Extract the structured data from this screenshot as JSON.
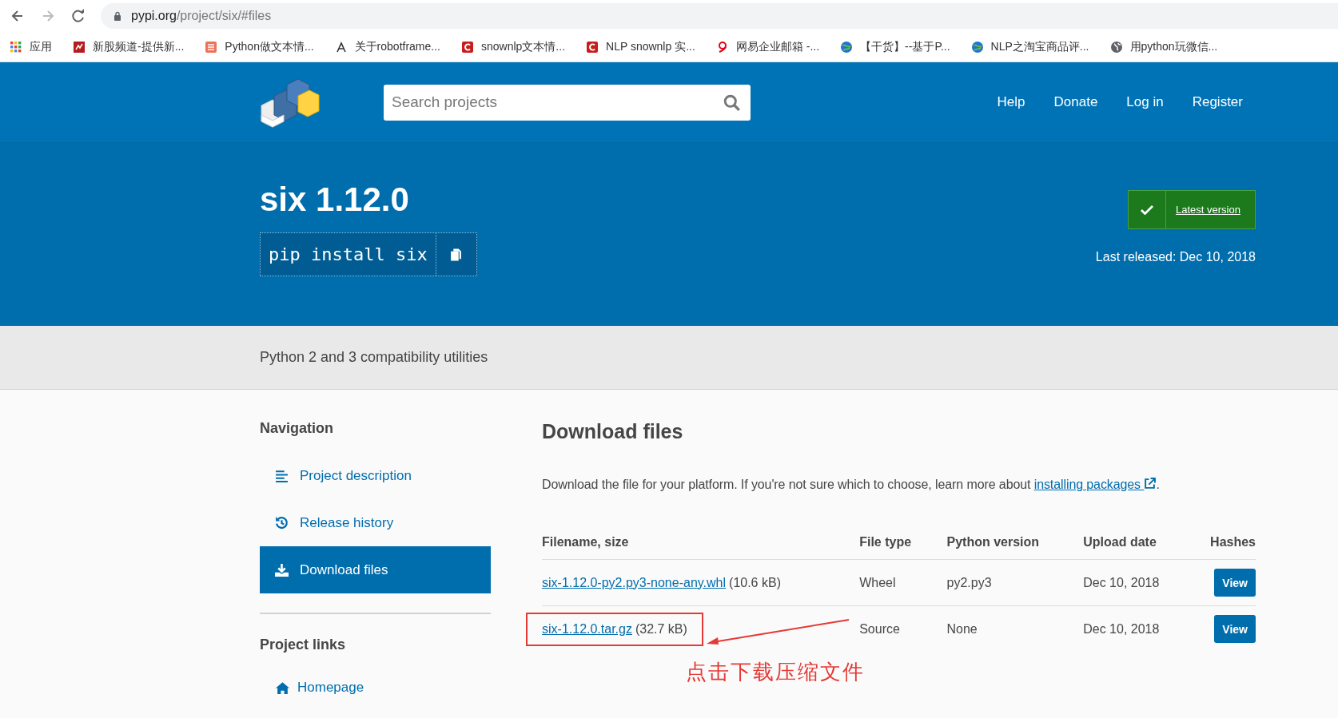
{
  "browser": {
    "url_host": "pypi.org",
    "url_path": "/project/six/#files",
    "bookmarks": [
      {
        "kind": "apps",
        "label": "应用"
      },
      {
        "kind": "stock",
        "label": "新股频道-提供新..."
      },
      {
        "kind": "jian",
        "label": "Python做文本情..."
      },
      {
        "kind": "robot",
        "label": "关于robotframe..."
      },
      {
        "kind": "csdn",
        "label": "snownlp文本情..."
      },
      {
        "kind": "csdn",
        "label": "NLP snownlp 实..."
      },
      {
        "kind": "netease",
        "label": "网易企业邮箱 -..."
      },
      {
        "kind": "globe",
        "label": "【干货】--基于P..."
      },
      {
        "kind": "globe",
        "label": "NLP之淘宝商品评..."
      },
      {
        "kind": "world",
        "label": "用python玩微信..."
      }
    ]
  },
  "header": {
    "search": {
      "placeholder": "Search projects"
    },
    "nav": [
      "Help",
      "Donate",
      "Log in",
      "Register"
    ]
  },
  "project": {
    "title": "six 1.12.0",
    "install_command": "pip install six",
    "latest_version": "Latest version",
    "last_released": "Last released: Dec 10, 2018",
    "summary": "Python 2 and 3 compatibility utilities"
  },
  "sidebar": {
    "heading": "Navigation",
    "items": [
      {
        "kind": "description",
        "label": "Project description",
        "selected": false
      },
      {
        "kind": "history",
        "label": "Release history",
        "selected": false
      },
      {
        "kind": "download",
        "label": "Download files",
        "selected": true
      }
    ],
    "links_heading": "Project links",
    "links": [
      {
        "kind": "home",
        "label": "Homepage"
      }
    ]
  },
  "main": {
    "heading": "Download files",
    "intro": "Download the file for your platform. If you're not sure which to choose, learn more about ",
    "intro_link": "installing packages",
    "intro_end": ".",
    "table": {
      "columns": [
        "Filename, size",
        "File type",
        "Python version",
        "Upload date",
        "Hashes"
      ],
      "rows": [
        {
          "filename": "six-1.12.0-py2.py3-none-any.whl",
          "size": "(10.6 kB)",
          "file_type": "Wheel",
          "python_version": "py2.py3",
          "upload_date": "Dec 10, 2018",
          "hashes": "View",
          "highlighted": false
        },
        {
          "filename": "six-1.12.0.tar.gz",
          "size": "(32.7 kB)",
          "file_type": "Source",
          "python_version": "None",
          "upload_date": "Dec 10, 2018",
          "hashes": "View",
          "highlighted": true
        }
      ]
    }
  },
  "annotation": {
    "text": "点击下载压缩文件"
  }
}
